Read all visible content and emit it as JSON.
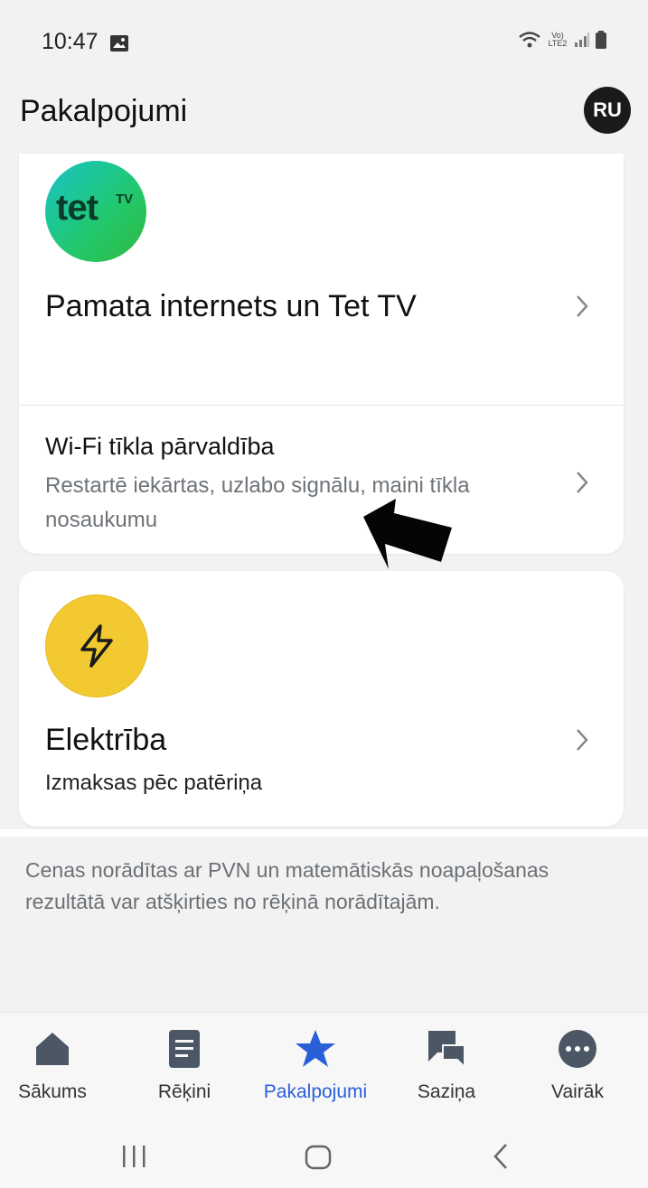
{
  "status": {
    "time": "10:47",
    "network_text": "Vo) LTE2"
  },
  "header": {
    "title": "Pakalpojumi",
    "avatar_initials": "RU"
  },
  "services": [
    {
      "logo_text": "tet",
      "logo_superscript": "TV",
      "title": "Pamata internets un Tet TV",
      "sub_item": {
        "title": "Wi-Fi tīkla pārvaldība",
        "description": "Restartē iekārtas, uzlabo signālu, maini tīkla nosaukumu"
      }
    },
    {
      "logo_icon": "lightning-icon",
      "title": "Elektrība",
      "description": "Izmaksas pēc patēriņa"
    }
  ],
  "note": "Cenas norādītas ar PVN un matemātiskās noapaļošanas rezultātā var atšķirties no rēķinā norādītajām.",
  "bottom_nav": {
    "items": [
      {
        "label": "Sākums",
        "icon": "home-icon"
      },
      {
        "label": "Rēķini",
        "icon": "document-icon"
      },
      {
        "label": "Pakalpojumi",
        "icon": "star-icon",
        "active": true
      },
      {
        "label": "Saziņa",
        "icon": "chat-icon"
      },
      {
        "label": "Vairāk",
        "icon": "more-icon"
      }
    ]
  },
  "colors": {
    "accent": "#2a5fd8",
    "electricity": "#f3c931",
    "background": "#f2f2f2"
  }
}
